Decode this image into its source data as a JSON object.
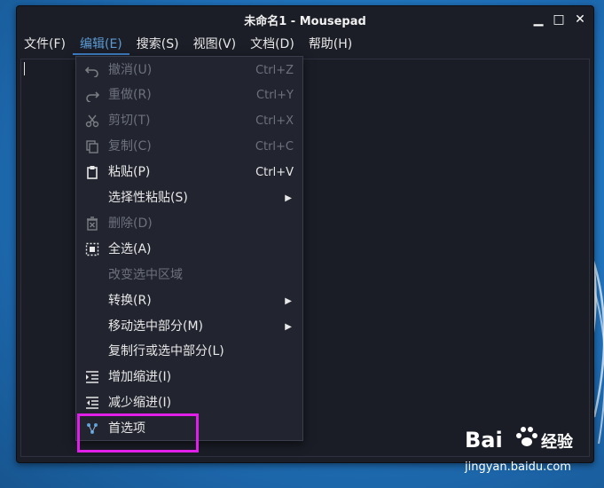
{
  "window": {
    "title": "未命名1 - Mousepad",
    "controls": {
      "minimize": "▁",
      "maximize": "□",
      "close": "✕"
    }
  },
  "menubar": [
    {
      "label": "文件(F)",
      "active": false
    },
    {
      "label": "编辑(E)",
      "active": true
    },
    {
      "label": "搜索(S)",
      "active": false
    },
    {
      "label": "视图(V)",
      "active": false
    },
    {
      "label": "文档(D)",
      "active": false
    },
    {
      "label": "帮助(H)",
      "active": false
    }
  ],
  "edit_menu": [
    {
      "label": "撤消(U)",
      "accel": "Ctrl+Z",
      "icon": "undo-icon",
      "enabled": false,
      "submenu": false
    },
    {
      "label": "重做(R)",
      "accel": "Ctrl+Y",
      "icon": "redo-icon",
      "enabled": false,
      "submenu": false
    },
    {
      "label": "剪切(T)",
      "accel": "Ctrl+X",
      "icon": "cut-icon",
      "enabled": false,
      "submenu": false
    },
    {
      "label": "复制(C)",
      "accel": "Ctrl+C",
      "icon": "copy-icon",
      "enabled": false,
      "submenu": false
    },
    {
      "label": "粘贴(P)",
      "accel": "Ctrl+V",
      "icon": "paste-icon",
      "enabled": true,
      "submenu": false
    },
    {
      "label": "选择性粘贴(S)",
      "accel": "",
      "icon": "",
      "enabled": true,
      "submenu": true
    },
    {
      "label": "删除(D)",
      "accel": "",
      "icon": "delete-icon",
      "enabled": false,
      "submenu": false
    },
    {
      "label": "全选(A)",
      "accel": "",
      "icon": "select-all-icon",
      "enabled": true,
      "submenu": false
    },
    {
      "label": "改变选中区域",
      "accel": "",
      "icon": "",
      "enabled": false,
      "submenu": false
    },
    {
      "label": "转换(R)",
      "accel": "",
      "icon": "",
      "enabled": true,
      "submenu": true
    },
    {
      "label": "移动选中部分(M)",
      "accel": "",
      "icon": "",
      "enabled": true,
      "submenu": true
    },
    {
      "label": "复制行或选中部分(L)",
      "accel": "",
      "icon": "",
      "enabled": true,
      "submenu": false
    },
    {
      "label": "增加缩进(I)",
      "accel": "",
      "icon": "indent-more-icon",
      "enabled": true,
      "submenu": false
    },
    {
      "label": "减少缩进(I)",
      "accel": "",
      "icon": "indent-less-icon",
      "enabled": true,
      "submenu": false
    },
    {
      "label": "首选项",
      "accel": "",
      "icon": "preferences-icon",
      "enabled": true,
      "submenu": false
    }
  ],
  "watermark": {
    "brand": "Bai",
    "brand_cn": "经验",
    "url": "jingyan.baidu.com"
  },
  "colors": {
    "highlight": "#e020e8",
    "active_menu": "#5b9bd5",
    "desktop": "#1f6fb8"
  }
}
